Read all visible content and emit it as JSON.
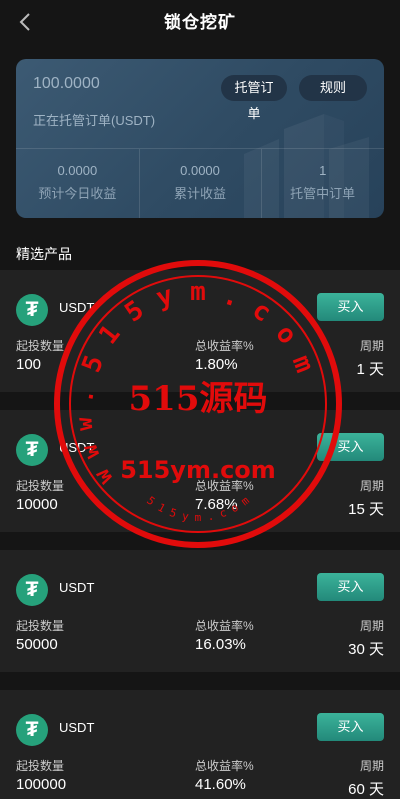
{
  "header": {
    "title": "锁仓挖矿"
  },
  "summary": {
    "amount": "100.0000",
    "hosting_label": "正在托管订单(USDT)",
    "orders_button": "托管订单",
    "rules_button": "规则",
    "stats": [
      {
        "value": "0.0000",
        "label": "预计今日收益"
      },
      {
        "value": "0.0000",
        "label": "累计收益"
      },
      {
        "value": "1",
        "label": "托管中订单"
      }
    ]
  },
  "section_title": "精选产品",
  "products": [
    {
      "coin": "USDT",
      "buy_label": "买入",
      "min_label": "起投数量",
      "min_value": "100",
      "rate_label": "总收益率%",
      "rate_value": "1.80%",
      "period_label": "周期",
      "period_value": "1 天"
    },
    {
      "coin": "USDT",
      "buy_label": "买入",
      "min_label": "起投数量",
      "min_value": "10000",
      "rate_label": "总收益率%",
      "rate_value": "7.68%",
      "period_label": "周期",
      "period_value": "15 天"
    },
    {
      "coin": "USDT",
      "buy_label": "买入",
      "min_label": "起投数量",
      "min_value": "50000",
      "rate_label": "总收益率%",
      "rate_value": "16.03%",
      "period_label": "周期",
      "period_value": "30 天"
    },
    {
      "coin": "USDT",
      "buy_label": "买入",
      "min_label": "起投数量",
      "min_value": "100000",
      "rate_label": "总收益率%",
      "rate_value": "41.60%",
      "period_label": "周期",
      "period_value": "60 天"
    }
  ],
  "watermark": {
    "ring_text": "5 1 5 y m . c o m",
    "left_text": "w w w .",
    "main_text": "515源码",
    "sub_text": "515ym.com",
    "bottom_text": "5 1 5 y m . c o m",
    "color": "#e10b0b"
  },
  "icons": {
    "back": "chevron-left-icon",
    "coin": "tether-logo"
  },
  "colors": {
    "background": "#151515",
    "card": "#222222",
    "summary_card": "#2f4b63",
    "buy_button": "#2a9a86",
    "coin": "#26a17b"
  }
}
